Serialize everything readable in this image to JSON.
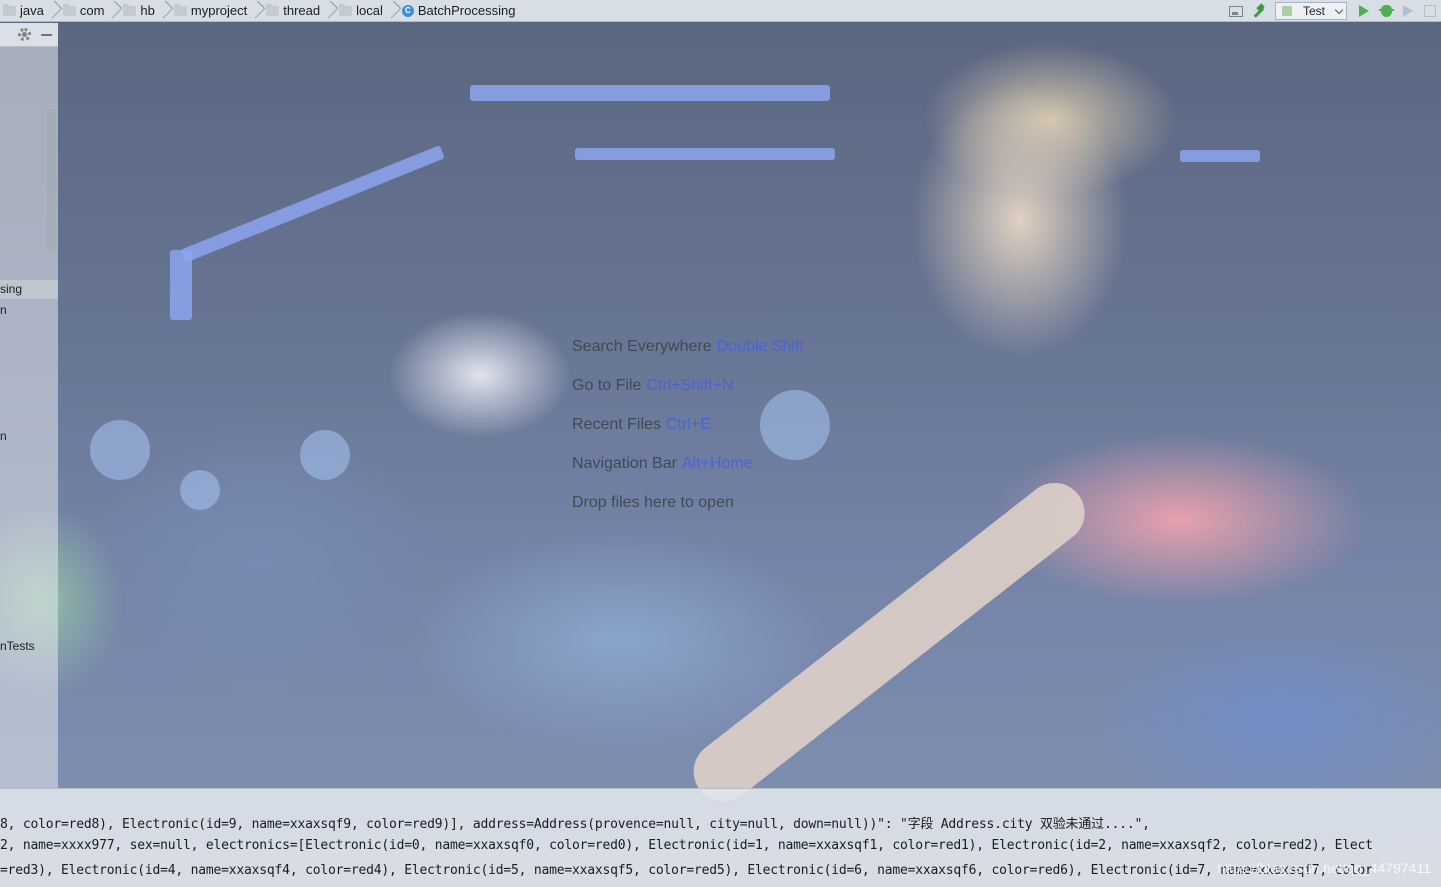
{
  "breadcrumbs": [
    {
      "label": "java",
      "icon": "folder-icon"
    },
    {
      "label": "com",
      "icon": "folder-icon"
    },
    {
      "label": "hb",
      "icon": "folder-icon"
    },
    {
      "label": "myproject",
      "icon": "folder-icon"
    },
    {
      "label": "thread",
      "icon": "folder-icon"
    },
    {
      "label": "local",
      "icon": "folder-icon"
    },
    {
      "label": "BatchProcessing",
      "icon": "class-icon",
      "icon_letter": "C"
    }
  ],
  "toolbar": {
    "run_config": "Test"
  },
  "project_tree": {
    "items": [
      {
        "label": "sing",
        "selected": true
      },
      {
        "label": "n",
        "selected": false
      },
      {
        "label": "n",
        "selected": false
      },
      {
        "label": "nTests",
        "selected": false
      }
    ]
  },
  "editor_hints": [
    {
      "text": "Search Everywhere",
      "shortcut": "Double Shift"
    },
    {
      "text": "Go to File",
      "shortcut": "Ctrl+Shift+N"
    },
    {
      "text": "Recent Files",
      "shortcut": "Ctrl+E"
    },
    {
      "text": "Navigation Bar",
      "shortcut": "Alt+Home"
    },
    {
      "text": "Drop files here to open",
      "shortcut": ""
    }
  ],
  "console": {
    "lines": [
      "8, color=red8), Electronic(id=9, name=xxaxsqf9, color=red9)], address=Address(provence=null, city=null, down=null))\": \"字段 Address.city 双验未通过....\",",
      "2, name=xxxx977, sex=null, electronics=[Electronic(id=0, name=xxaxsqf0, color=red0), Electronic(id=1, name=xxaxsqf1, color=red1), Electronic(id=2, name=xxaxsqf2, color=red2), Elect",
      "=red3), Electronic(id=4, name=xxaxsqf4, color=red4), Electronic(id=5, name=xxaxsqf5, color=red5), Electronic(id=6, name=xxaxsqf6, color=red6), Electronic(id=7, name=xxaxsqf7, color"
    ],
    "watermark": "https://blog.csdn.net/qq_44797411"
  }
}
